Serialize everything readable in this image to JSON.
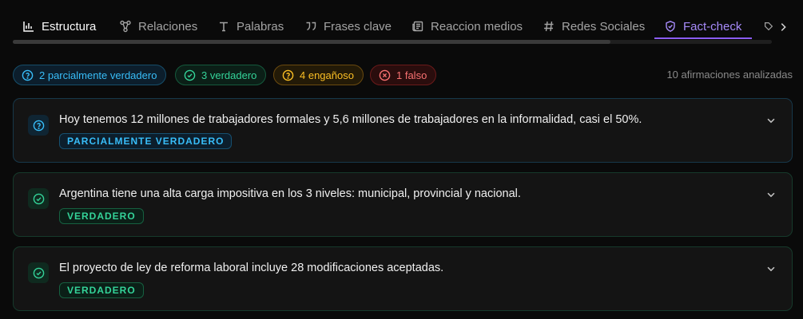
{
  "tabs": [
    {
      "label": "Estructura",
      "icon": "bar-chart-icon"
    },
    {
      "label": "Relaciones",
      "icon": "network-icon"
    },
    {
      "label": "Palabras",
      "icon": "type-icon"
    },
    {
      "label": "Frases clave",
      "icon": "quote-icon"
    },
    {
      "label": "Reaccion medios",
      "icon": "newspaper-icon"
    },
    {
      "label": "Redes Sociales",
      "icon": "hash-icon"
    },
    {
      "label": "Fact-check",
      "icon": "shield-check-icon"
    }
  ],
  "active_tab": "Fact-check",
  "summary": {
    "partial": "2 parcialmente verdadero",
    "true": "3 verdadero",
    "misleading": "4 engañoso",
    "false": "1 falso",
    "analyzed": "10 afirmaciones analizadas"
  },
  "claims": [
    {
      "text": "Hoy tenemos 12 millones de trabajadores formales y 5,6 millones de trabajadores en la informalidad, casi el 50%.",
      "verdict": "PARCIALMENTE VERDADERO",
      "status": "partial"
    },
    {
      "text": "Argentina tiene una alta carga impositiva en los 3 niveles: municipal, provincial y nacional.",
      "verdict": "VERDADERO",
      "status": "true"
    },
    {
      "text": "El proyecto de ley de reforma laboral incluye 28 modificaciones aceptadas.",
      "verdict": "VERDADERO",
      "status": "true"
    }
  ],
  "colors": {
    "accent": "#8b5cf6",
    "partial": "#38bdf8",
    "true": "#34d399",
    "misleading": "#fbbf24",
    "false": "#f87171"
  }
}
